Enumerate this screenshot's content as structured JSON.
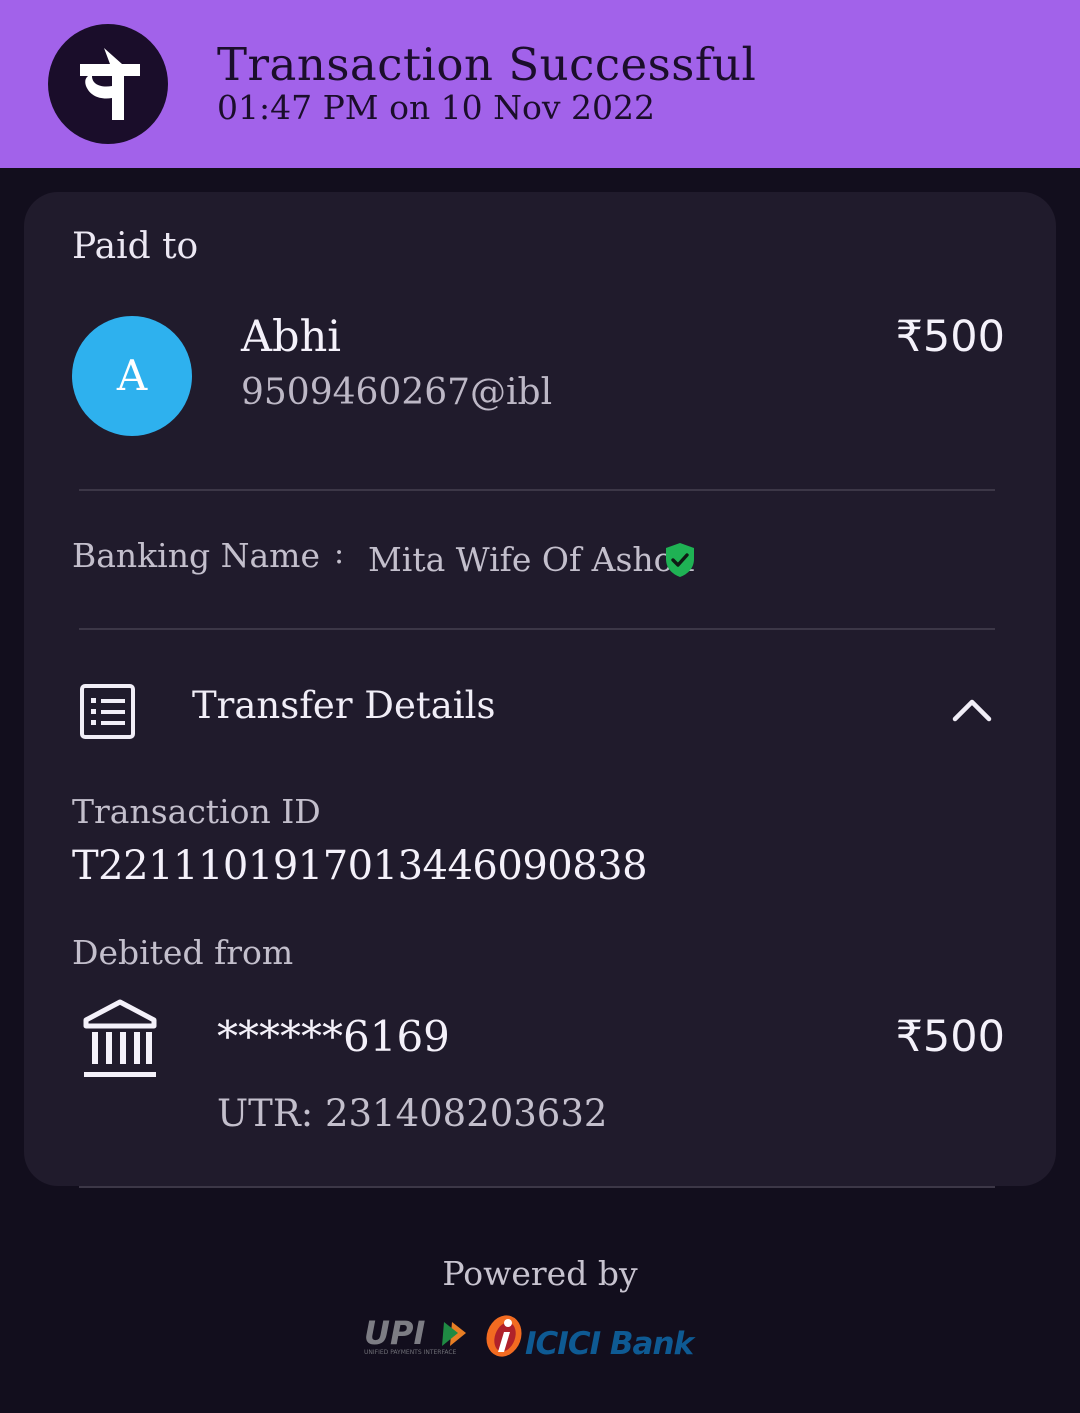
{
  "header": {
    "title": "Transaction Successful",
    "subtitle": "01:47 PM on 10 Nov 2022",
    "logo_glyph": "पे",
    "logo_icon": "phonepe-logo-icon"
  },
  "payee": {
    "section_label": "Paid to",
    "avatar_letter": "A",
    "name": "Abhi",
    "upi_id": "9509460267@ibl",
    "amount": "₹500"
  },
  "banking_name": {
    "label": "Banking Name",
    "separator": ":",
    "value": "Mita Wife Of Ashok",
    "verified_icon": "verified-shield-icon"
  },
  "transfer": {
    "title": "Transfer Details",
    "icon": "list-icon",
    "toggle_icon": "chevron-up-icon",
    "transaction_id_label": "Transaction ID",
    "transaction_id": "T2211101917013446090838",
    "debited_from_label": "Debited from",
    "account": "******6169",
    "amount": "₹500",
    "utr": "UTR: 231408203632",
    "bank_icon": "bank-icon"
  },
  "footer": {
    "powered_by": "Powered by",
    "upi_logo_text": "UPI",
    "upi_tagline": "UNIFIED PAYMENTS INTERFACE",
    "bank_logo_text": "ICICI Bank"
  },
  "colors": {
    "header_bg": "#a262ea",
    "page_bg": "#120e1d",
    "card_bg": "#201b2c",
    "avatar_bg": "#2eb1ee",
    "verified_green": "#1fb254",
    "icici_blue": "#0e5a93",
    "icici_orange": "#f26b21"
  }
}
